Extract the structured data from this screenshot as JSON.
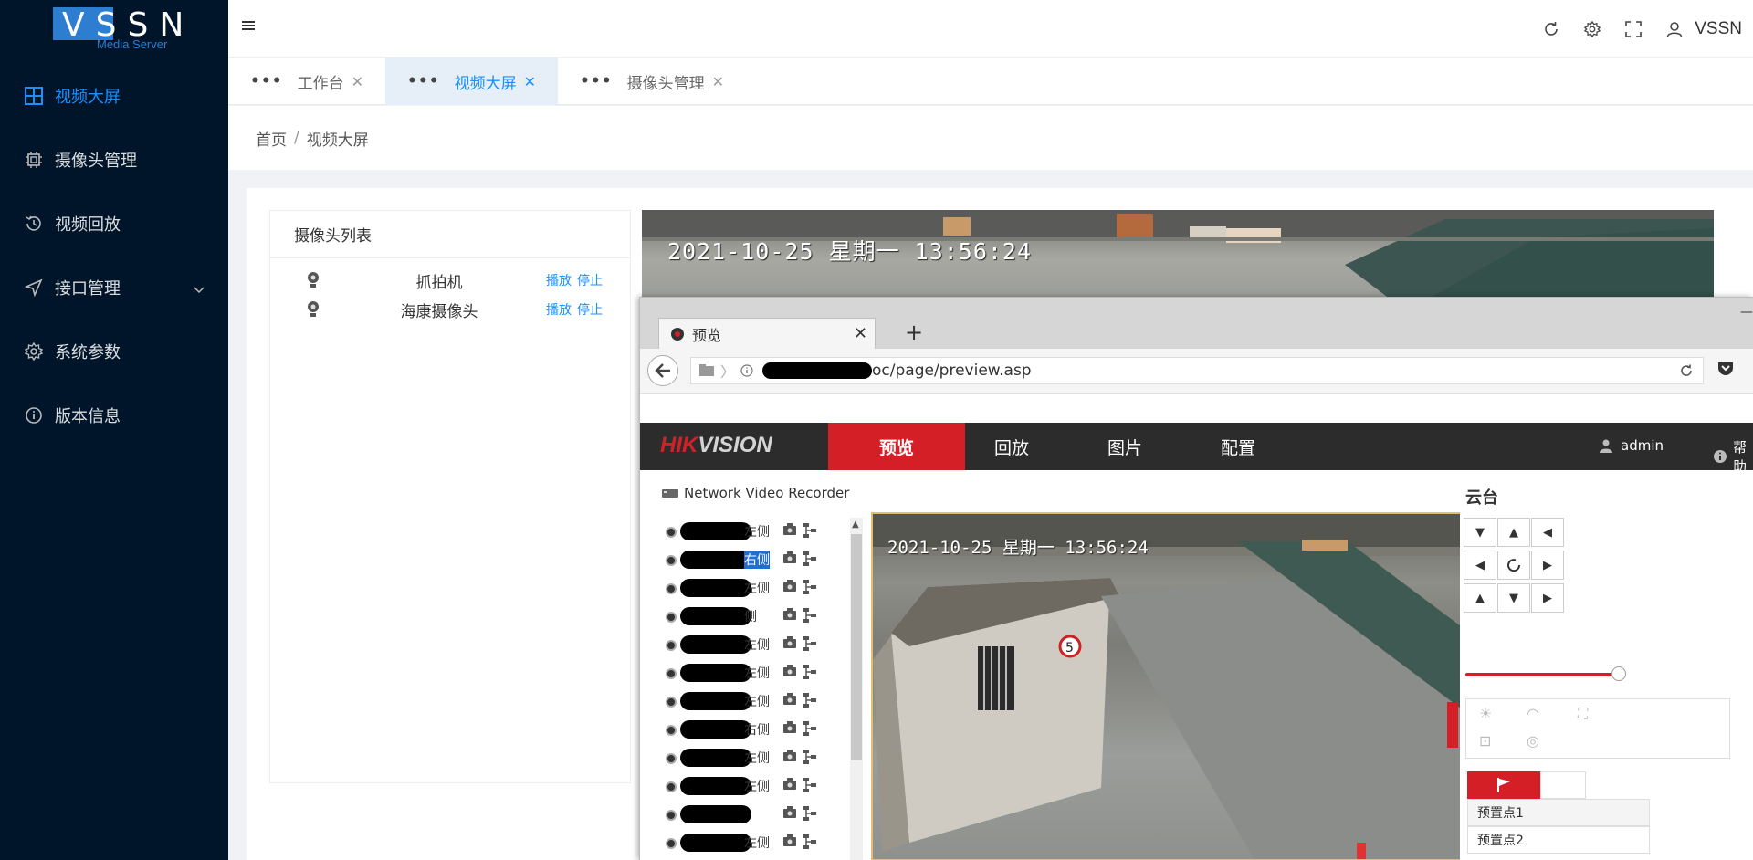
{
  "app": {
    "logo_text": "VSSN",
    "logo_sub": "Media Server"
  },
  "sidebar": {
    "items": [
      {
        "label": "视频大屏",
        "icon": "grid-icon",
        "active": true
      },
      {
        "label": "摄像头管理",
        "icon": "chip-icon",
        "active": false
      },
      {
        "label": "视频回放",
        "icon": "history-icon",
        "active": false
      },
      {
        "label": "接口管理",
        "icon": "send-icon",
        "active": false,
        "has_arrow": true
      },
      {
        "label": "系统参数",
        "icon": "gear-icon",
        "active": false
      },
      {
        "label": "版本信息",
        "icon": "info-icon",
        "active": false
      }
    ]
  },
  "header": {
    "user": "VSSN"
  },
  "tabs": [
    {
      "label": "工作台",
      "active": false
    },
    {
      "label": "视频大屏",
      "active": true
    },
    {
      "label": "摄像头管理",
      "active": false
    }
  ],
  "breadcrumb": {
    "home": "首页",
    "sep": "/",
    "current": "视频大屏"
  },
  "camera_list": {
    "title": "摄像头列表",
    "play_label": "播放",
    "stop_label": "停止",
    "items": [
      {
        "name": "抓拍机"
      },
      {
        "name": "海康摄像头"
      }
    ]
  },
  "video_top": {
    "timestamp": "2021-10-25 星期一 13:56:24"
  },
  "browser": {
    "tab_title": "预览",
    "new_tab": "+",
    "url_visible": "oc/page/preview.asp"
  },
  "hik": {
    "logo_red": "HIK",
    "logo_white": "VISION",
    "nav": [
      "预览",
      "回放",
      "图片",
      "配置"
    ],
    "user": "admin",
    "help": "帮助",
    "nvr_title": "Network Video Recorder",
    "channels": [
      {
        "suffix": "左侧",
        "selected": false
      },
      {
        "suffix": "右侧",
        "selected": true
      },
      {
        "suffix": "左侧",
        "selected": false
      },
      {
        "suffix": "侧",
        "selected": false
      },
      {
        "suffix": "左侧",
        "selected": false
      },
      {
        "suffix": "左侧",
        "selected": false
      },
      {
        "suffix": "左侧",
        "selected": false
      },
      {
        "suffix": "右侧",
        "selected": false
      },
      {
        "suffix": "左侧",
        "selected": false
      },
      {
        "suffix": "左侧",
        "selected": false
      },
      {
        "suffix": "",
        "selected": false
      },
      {
        "suffix": "左侧",
        "selected": false
      }
    ],
    "video_timestamp": "2021-10-25 星期一 13:56:24",
    "ptz_title": "云台",
    "presets": [
      "预置点1",
      "预置点2"
    ]
  },
  "colors": {
    "sidebar_bg": "#001529",
    "accent": "#1890ff",
    "hik_red": "#d41f26"
  }
}
